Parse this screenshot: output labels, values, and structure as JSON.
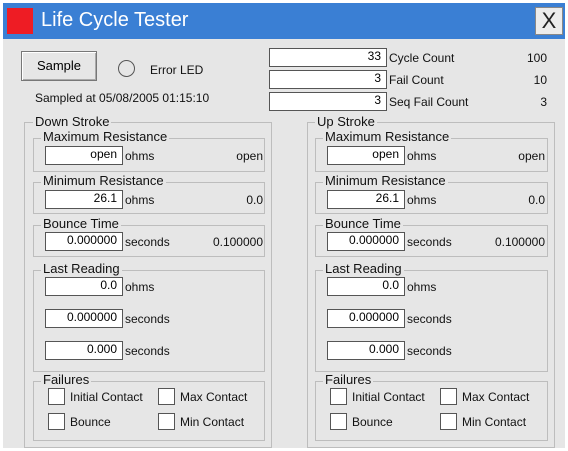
{
  "window": {
    "title": "Life Cycle Tester",
    "close_label": "X"
  },
  "top": {
    "sample_label": "Sample",
    "error_led_label": "Error LED",
    "sampled_at": "Sampled at 05/08/2005 01:15:10",
    "counters": [
      {
        "value": "33",
        "label": "Cycle Count",
        "limit": "100"
      },
      {
        "value": "3",
        "label": "Fail Count",
        "limit": "10"
      },
      {
        "value": "3",
        "label": "Seq Fail Count",
        "limit": "3"
      }
    ]
  },
  "down": {
    "title": "Down Stroke",
    "max_res": {
      "title": "Maximum Resistance",
      "value": "open",
      "unit": "ohms",
      "limit": "open"
    },
    "min_res": {
      "title": "Minimum Resistance",
      "value": "26.1",
      "unit": "ohms",
      "limit": "0.0"
    },
    "bounce": {
      "title": "Bounce Time",
      "value": "0.000000",
      "unit": "seconds",
      "limit": "0.100000"
    },
    "last": {
      "title": "Last Reading",
      "rows": [
        {
          "value": "0.0",
          "unit": "ohms"
        },
        {
          "value": "0.000000",
          "unit": "seconds"
        },
        {
          "value": "0.000",
          "unit": "seconds"
        }
      ]
    },
    "failures": {
      "title": "Failures",
      "initial": "Initial Contact",
      "max": "Max Contact",
      "bounce": "Bounce",
      "min": "Min Contact"
    }
  },
  "up": {
    "title": "Up Stroke",
    "max_res": {
      "title": "Maximum Resistance",
      "value": "open",
      "unit": "ohms",
      "limit": "open"
    },
    "min_res": {
      "title": "Minimum Resistance",
      "value": "26.1",
      "unit": "ohms",
      "limit": "0.0"
    },
    "bounce": {
      "title": "Bounce Time",
      "value": "0.000000",
      "unit": "seconds",
      "limit": "0.100000"
    },
    "last": {
      "title": "Last Reading",
      "rows": [
        {
          "value": "0.0",
          "unit": "ohms"
        },
        {
          "value": "0.000000",
          "unit": "seconds"
        },
        {
          "value": "0.000",
          "unit": "seconds"
        }
      ]
    },
    "failures": {
      "title": "Failures",
      "initial": "Initial Contact",
      "max": "Max Contact",
      "bounce": "Bounce",
      "min": "Min Contact"
    }
  },
  "colors": {
    "titlebar": "#3a7fd4",
    "title_icon": "#ee1c24",
    "panel": "#e6e6e6"
  }
}
